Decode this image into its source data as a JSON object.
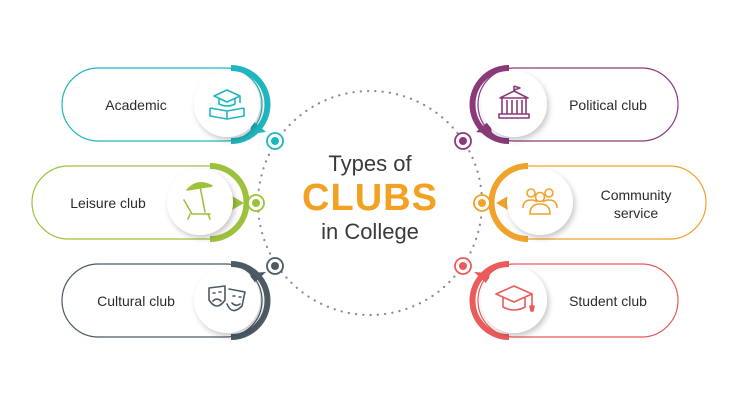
{
  "title": {
    "line1": "Types of",
    "line2": "CLUBS",
    "line3": "in College"
  },
  "colors": {
    "orange": "#f2a122",
    "teal": "#20b6c0",
    "lime": "#9cc23c",
    "slate": "#4b5a63",
    "purple": "#8a3a7a",
    "amber": "#f0a22b",
    "coral": "#ea5b5b",
    "text": "#2b2b2b",
    "dots": "#8a8a8a"
  },
  "clubs": [
    {
      "label": "Academic",
      "icon": "graduation-book-icon",
      "color": "#20b6c0"
    },
    {
      "label": "Leisure club",
      "icon": "beach-umbrella-icon",
      "color": "#9cc23c"
    },
    {
      "label": "Cultural club",
      "icon": "theater-masks-icon",
      "color": "#4b5a63"
    },
    {
      "label": "Political club",
      "icon": "government-building-icon",
      "color": "#8a3a7a"
    },
    {
      "label": "Community service",
      "label_line1": "Community",
      "label_line2": "service",
      "icon": "people-group-icon",
      "color": "#f0a22b"
    },
    {
      "label": "Student club",
      "icon": "graduation-cap-icon",
      "color": "#ea5b5b"
    }
  ]
}
